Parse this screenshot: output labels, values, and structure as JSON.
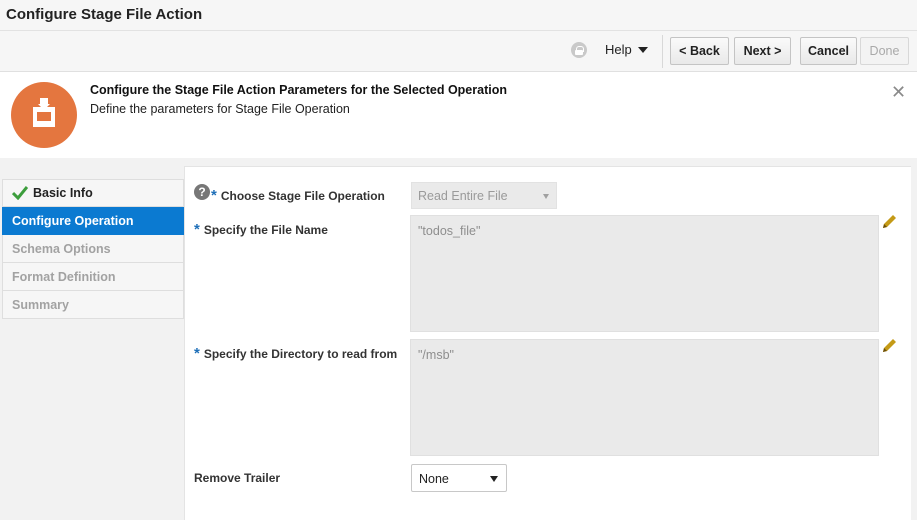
{
  "window": {
    "title": "Configure Stage File Action"
  },
  "toolbar": {
    "help_label": "Help",
    "back_label": "< Back",
    "next_label": "Next >",
    "cancel_label": "Cancel",
    "done_label": "Done"
  },
  "header": {
    "title": "Configure the Stage File Action Parameters for the Selected Operation",
    "subtitle": "Define the parameters for Stage File Operation",
    "close_glyph": "✕"
  },
  "train": {
    "items": [
      {
        "label": "Basic Info",
        "state": "completed"
      },
      {
        "label": "Configure Operation",
        "state": "active"
      },
      {
        "label": "Schema Options",
        "state": "pending"
      },
      {
        "label": "Format Definition",
        "state": "pending"
      },
      {
        "label": "Summary",
        "state": "pending"
      }
    ]
  },
  "form": {
    "help_glyph": "?",
    "required_mark": "*",
    "operation": {
      "label": "Choose Stage File Operation",
      "value": "Read Entire File"
    },
    "file_name": {
      "label": "Specify the File Name",
      "value": "\"todos_file\""
    },
    "directory": {
      "label": "Specify the Directory to read from",
      "value": "\"/msb\""
    },
    "remove_trailer": {
      "label": "Remove Trailer",
      "value": "None"
    }
  },
  "colors": {
    "accent": "#0b7ad1",
    "stage_icon": "#e4763f",
    "required": "#1e6fb8",
    "check": "#3c9d3c",
    "pencil": "#c49a16"
  },
  "icons": [
    "lock-icon",
    "chevron-down-icon",
    "close-icon",
    "stage-file-icon",
    "checkmark-icon",
    "help-icon",
    "pencil-icon"
  ]
}
